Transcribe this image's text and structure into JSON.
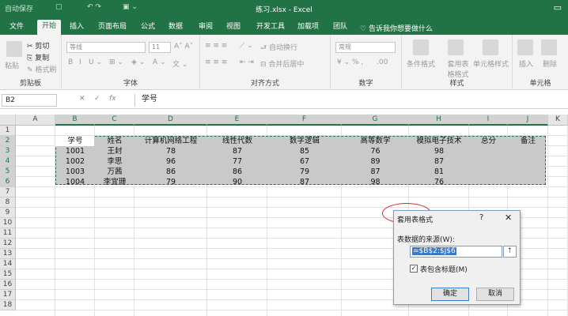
{
  "titlebar": {
    "autosave": "自动保存",
    "autosave_state": "关",
    "window_title": "练习.xlsx - Excel"
  },
  "tabs": [
    "文件",
    "开始",
    "插入",
    "页面布局",
    "公式",
    "数据",
    "审阅",
    "视图",
    "开发工具",
    "加载项",
    "团队"
  ],
  "active_tab": "开始",
  "tellme": "告诉我你想要做什么",
  "ribbon": {
    "clipboard": {
      "paste": "粘贴",
      "cut": "剪切",
      "copy": "复制",
      "format_painter": "格式刷",
      "label": "剪贴板"
    },
    "font": {
      "name": "等线",
      "size": "11",
      "label": "字体"
    },
    "alignment": {
      "wrap": "自动换行",
      "merge": "合并后居中",
      "label": "对齐方式"
    },
    "number": {
      "format": "常规",
      "label": "数字"
    },
    "styles": {
      "conditional": "条件格式",
      "as_table": "套用表格格式",
      "cell_styles": "单元格样式",
      "label": "样式"
    },
    "cells": {
      "insert": "插入",
      "delete": "删除",
      "label": "单元格"
    }
  },
  "formula_bar": {
    "name_box": "B2",
    "formula": "学号"
  },
  "grid": {
    "columns": [
      "A",
      "B",
      "C",
      "D",
      "E",
      "F",
      "G",
      "H",
      "I",
      "J",
      "K"
    ],
    "rows": [
      "1",
      "2",
      "3",
      "4",
      "5",
      "6",
      "7",
      "8",
      "9",
      "10",
      "11",
      "12",
      "13",
      "14",
      "15",
      "16",
      "17",
      "18"
    ],
    "header_row": [
      "学号",
      "姓名",
      "计算机网络工程",
      "线性代数",
      "数字逻辑",
      "高等数学",
      "模拟电子技术",
      "总分",
      "备注"
    ],
    "data_rows": [
      [
        "1001",
        "王封",
        "78",
        "87",
        "85",
        "76",
        "98",
        "",
        ""
      ],
      [
        "1002",
        "李思",
        "96",
        "77",
        "67",
        "89",
        "87",
        "",
        ""
      ],
      [
        "1003",
        "万茜",
        "86",
        "86",
        "79",
        "87",
        "81",
        "",
        ""
      ],
      [
        "1004",
        "李宜珊",
        "79",
        "90",
        "87",
        "98",
        "76",
        "",
        ""
      ]
    ]
  },
  "dialog": {
    "title": "套用表格式",
    "help": "?",
    "close": "✕",
    "source_label": "表数据的来源(W):",
    "source_value": "=$B$2:$J$6",
    "checkbox_label": "表包含标题(M)",
    "checkbox_checked": true,
    "ok": "确定",
    "cancel": "取消"
  },
  "colors": {
    "excel_green": "#217346",
    "selection_gray": "#c9c9c9",
    "annotation_red": "#d7262e"
  }
}
